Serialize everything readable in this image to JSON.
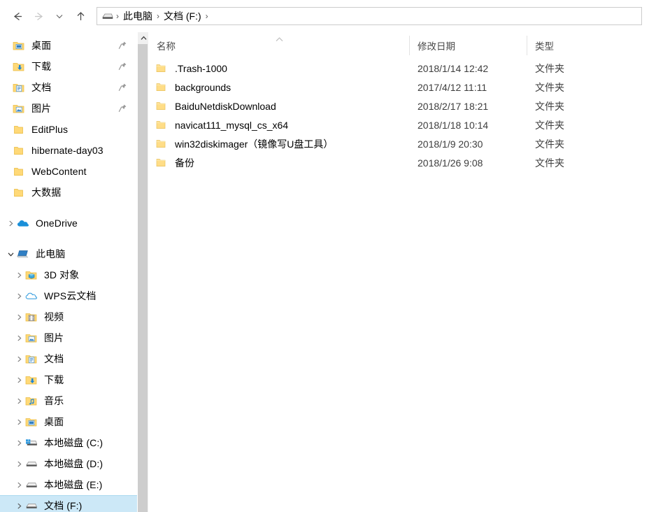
{
  "window": {
    "title": "文档 (F:)"
  },
  "toolbar": {
    "back": "back-arrow",
    "forward": "forward-arrow",
    "recent": "recent-locations",
    "up": "up-arrow"
  },
  "address_bar": {
    "drive_icon": "hard-drive-icon",
    "crumbs": [
      "此电脑",
      "文档 (F:)"
    ],
    "separator": "›"
  },
  "sidebar": {
    "quick_access": [
      {
        "label": "桌面",
        "icon": "folder-desktop-icon",
        "pinned": true,
        "chevron": false
      },
      {
        "label": "下载",
        "icon": "folder-download-icon",
        "pinned": true,
        "chevron": false
      },
      {
        "label": "文档",
        "icon": "folder-documents-icon",
        "pinned": true,
        "chevron": false
      },
      {
        "label": "图片",
        "icon": "folder-pictures-icon",
        "pinned": true,
        "chevron": false
      },
      {
        "label": "EditPlus",
        "icon": "folder-icon",
        "pinned": false,
        "chevron": false
      },
      {
        "label": "hibernate-day03",
        "icon": "folder-icon",
        "pinned": false,
        "chevron": false
      },
      {
        "label": "WebContent",
        "icon": "folder-icon",
        "pinned": false,
        "chevron": false
      },
      {
        "label": "大数据",
        "icon": "folder-icon",
        "pinned": false,
        "chevron": false
      }
    ],
    "onedrive": {
      "label": "OneDrive",
      "icon": "onedrive-cloud-icon",
      "expanded": false
    },
    "this_pc": {
      "label": "此电脑",
      "icon": "computer-icon",
      "expanded": true
    },
    "this_pc_children": [
      {
        "label": "3D 对象",
        "icon": "folder-3d-objects-icon"
      },
      {
        "label": "WPS云文档",
        "icon": "wps-cloud-icon"
      },
      {
        "label": "视频",
        "icon": "folder-videos-icon"
      },
      {
        "label": "图片",
        "icon": "folder-pictures-icon"
      },
      {
        "label": "文档",
        "icon": "folder-documents-icon"
      },
      {
        "label": "下载",
        "icon": "folder-download-icon"
      },
      {
        "label": "音乐",
        "icon": "folder-music-icon"
      },
      {
        "label": "桌面",
        "icon": "folder-desktop-icon"
      },
      {
        "label": "本地磁盘 (C:)",
        "icon": "system-drive-icon"
      },
      {
        "label": "本地磁盘 (D:)",
        "icon": "hard-drive-icon"
      },
      {
        "label": "本地磁盘 (E:)",
        "icon": "hard-drive-icon"
      },
      {
        "label": "文档 (F:)",
        "icon": "hard-drive-icon",
        "selected": true
      }
    ]
  },
  "file_list": {
    "columns": [
      {
        "key": "name",
        "label": "名称",
        "sorted": true,
        "sort_dir": "asc"
      },
      {
        "key": "date",
        "label": "修改日期",
        "sorted": false
      },
      {
        "key": "type",
        "label": "类型",
        "sorted": false
      }
    ],
    "rows": [
      {
        "name": ".Trash-1000",
        "date": "2018/1/14 12:42",
        "type": "文件夹",
        "icon": "folder-icon"
      },
      {
        "name": "backgrounds",
        "date": "2017/4/12 11:11",
        "type": "文件夹",
        "icon": "folder-icon"
      },
      {
        "name": "BaiduNetdiskDownload",
        "date": "2018/2/17 18:21",
        "type": "文件夹",
        "icon": "folder-icon"
      },
      {
        "name": "navicat111_mysql_cs_x64",
        "date": "2018/1/18 10:14",
        "type": "文件夹",
        "icon": "folder-icon"
      },
      {
        "name": "win32diskimager（镜像写U盘工具）",
        "date": "2018/1/9 20:30",
        "type": "文件夹",
        "icon": "folder-icon"
      },
      {
        "name": "备份",
        "date": "2018/1/26 9:08",
        "type": "文件夹",
        "icon": "folder-icon"
      }
    ]
  },
  "colors": {
    "selection": "#cce8f7",
    "selection_border": "#a8d8ef",
    "folder_yellow": "#ffd264",
    "scrollbar_track": "#f0f0f0",
    "scrollbar_thumb": "#cdcdcd",
    "header_text": "#4a4a4a"
  }
}
